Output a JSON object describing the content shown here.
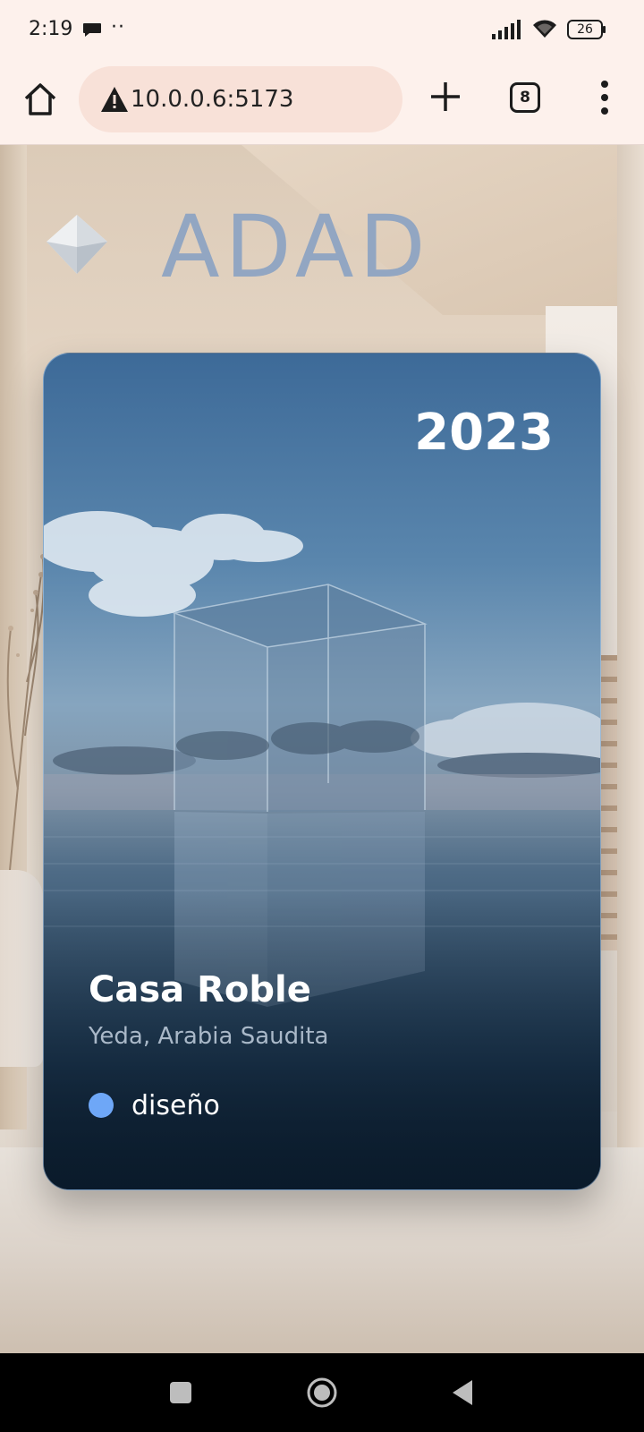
{
  "status_bar": {
    "time": "2:19",
    "dots": "··",
    "battery": "26"
  },
  "browser": {
    "url": "10.0.0.6:5173",
    "tab_count": "8",
    "icons": [
      "home-icon",
      "warning-icon",
      "plus-icon",
      "tabs-icon",
      "more-vert-icon"
    ]
  },
  "logo": {
    "text": "ADAD",
    "color": "#8aa2c3"
  },
  "card": {
    "year": "2023",
    "title": "Casa Roble",
    "location": "Yeda, Arabia Saudita",
    "tag": {
      "label": "diseño",
      "color": "#6ea7f7"
    }
  },
  "nav": {
    "icons": [
      "recents-square-icon",
      "home-circle-icon",
      "back-triangle-icon"
    ]
  }
}
